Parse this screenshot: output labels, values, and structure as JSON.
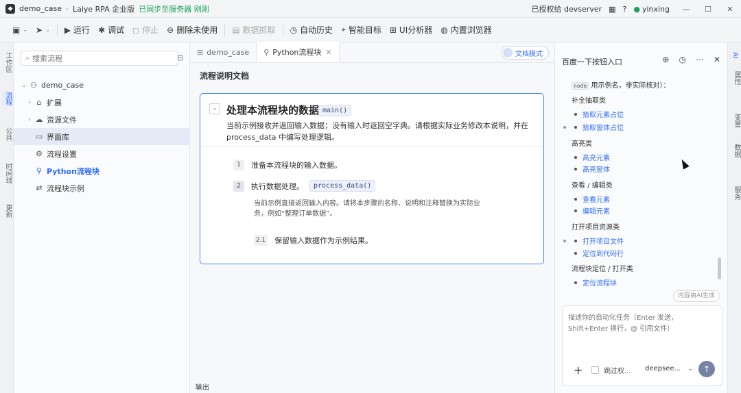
{
  "titlebar": {
    "project": "demo_case",
    "app": "Laiye RPA 企业版",
    "sync": "已同步至服务器 刚刚",
    "license": "已授权给 devserver",
    "user": "yinxing",
    "help": "?"
  },
  "toolbar": {
    "run": "运行",
    "debug": "调试",
    "stop": "停止",
    "remove_unused": "删除未使用",
    "data_capture": "数据抓取",
    "auto_history": "自动历史",
    "smart_target": "智能目标",
    "ui_analyzer": "UI分析器",
    "browser": "内置浏览器"
  },
  "left_rail": {
    "items": [
      "工作区",
      "流程",
      "公共",
      "时间线",
      "更新"
    ]
  },
  "sidebar": {
    "search_placeholder": "搜索流程",
    "tree": {
      "root": "demo_case",
      "expand": "扩展",
      "resources": "资源文件",
      "ui_library": "界面库",
      "flow_settings": "流程设置",
      "python_block": "Python流程块",
      "block_example": "流程块示例"
    }
  },
  "editor": {
    "tabs": [
      {
        "label": "demo_case"
      },
      {
        "label": "Python流程块"
      }
    ],
    "doc_mode": "文档模式",
    "doc_title": "流程说明文档",
    "card": {
      "title": "处理本流程块的数据。",
      "func": "main()",
      "desc": "当前示例接收并返回输入数据；没有输入时返回空字典。请根据实际业务修改本说明，并在 process_data 中编写处理逻辑。",
      "steps": [
        {
          "num": "1",
          "text": "准备本流程块的输入数据。"
        },
        {
          "num": "2",
          "text": "执行数据处理。",
          "code": "process_data()"
        }
      ],
      "note": "当前示例直接返回输入内容。请将本步骤的名称、说明和注释替换为实际业务，例如“整理订单数据”。",
      "sub_step": {
        "num": "2.1",
        "text": "保留输入数据作为示例结果。"
      }
    },
    "output_label": "输出"
  },
  "ai_panel": {
    "title": "百度一下按钮入口",
    "intro_code": "node",
    "intro_text": "用示例名，非实际核对）：",
    "groups": [
      {
        "title": "补全抽取类",
        "links": [
          "拾取元素占位",
          "拾取窗体占位"
        ]
      },
      {
        "title": "高亮类",
        "links": [
          "高亮元素",
          "高亮窗体"
        ]
      },
      {
        "title": "查看 / 编辑类",
        "links": [
          "查看元素",
          "编辑元素"
        ]
      },
      {
        "title": "打开项目资源类",
        "links": [
          "打开项目文件",
          "定位到代码行"
        ]
      },
      {
        "title": "流程块定位 / 打开类",
        "links": [
          "定位流程块"
        ]
      }
    ],
    "ai_generated": "内容由AI生成",
    "input_placeholder": "描述你的自动化任务（Enter 发送，Shift+Enter 换行，@ 引用文件）",
    "skip": "跳过权...",
    "model": "deepsee..."
  },
  "right_rail": {
    "items": [
      "AI",
      "属性",
      "变量",
      "数据",
      "服务"
    ]
  },
  "colors": {
    "accent": "#2f6bff",
    "card_border": "#4b86ef",
    "sync": "#19a35a"
  }
}
